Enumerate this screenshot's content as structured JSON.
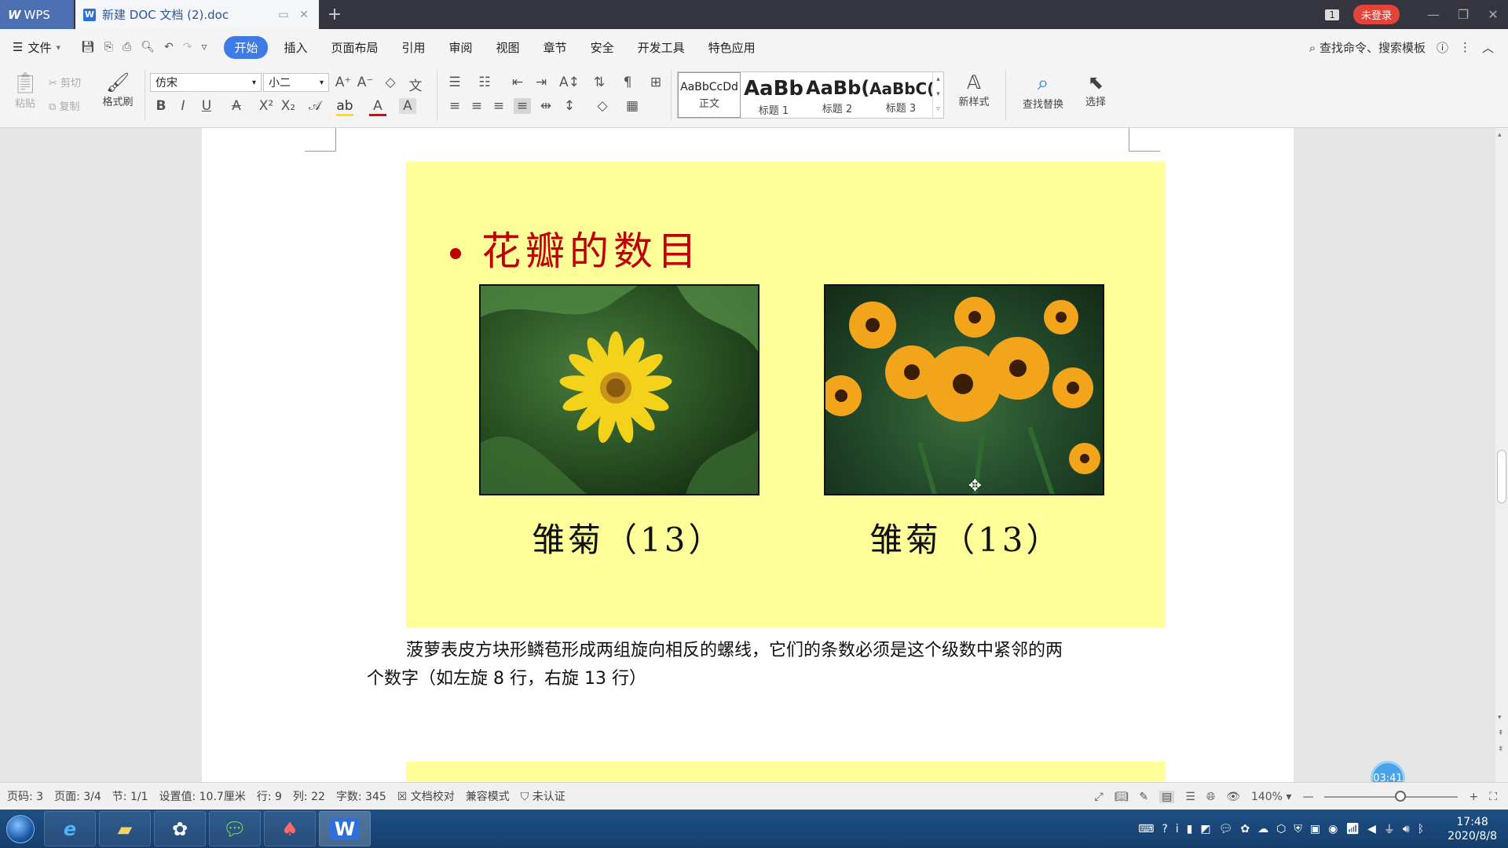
{
  "titlebar": {
    "app_name": "WPS",
    "doc_tab_title": "新建 DOC 文档 (2).doc",
    "window_count": "1",
    "login_label": "未登录"
  },
  "menubar": {
    "file_label": "文件",
    "items": [
      "开始",
      "插入",
      "页面布局",
      "引用",
      "审阅",
      "视图",
      "章节",
      "安全",
      "开发工具",
      "特色应用"
    ],
    "active_item": "开始",
    "search_label": "查找命令、搜索模板"
  },
  "ribbon": {
    "paste_label": "粘贴",
    "cut_label": "剪切",
    "copy_label": "复制",
    "format_painter_label": "格式刷",
    "font_name": "仿宋",
    "font_size": "小二",
    "styles": [
      {
        "sample": "AaBbCcDd",
        "label": "正文"
      },
      {
        "sample": "AaBb",
        "label": "标题 1"
      },
      {
        "sample": "AaBb(",
        "label": "标题 2"
      },
      {
        "sample": "AaBbC(",
        "label": "标题 3"
      }
    ],
    "new_style_label": "新样式",
    "find_replace_label": "查找替换",
    "select_label": "选择"
  },
  "document": {
    "slide_title": "花瓣的数目",
    "caption_left": "雏菊（13）",
    "caption_right": "雏菊（13）",
    "paragraph_line1": "菠萝表皮方块形鳞苞形成两组旋向相反的螺线，它们的条数必须是这个级数中紧邻的两",
    "paragraph_line2": "个数字（如左旋 8 行，右旋 13 行）"
  },
  "statusbar": {
    "page_code": "页码: 3",
    "page": "页面: 3/4",
    "section": "节: 1/1",
    "setting": "设置值: 10.7厘米",
    "row": "行: 9",
    "col": "列: 22",
    "word_count": "字数: 345",
    "proofread": "文档校对",
    "compat_mode": "兼容模式",
    "unverified": "未认证",
    "zoom": "140%",
    "timer": "03:41"
  },
  "taskbar": {
    "time": "17:48",
    "date": "2020/8/8"
  }
}
